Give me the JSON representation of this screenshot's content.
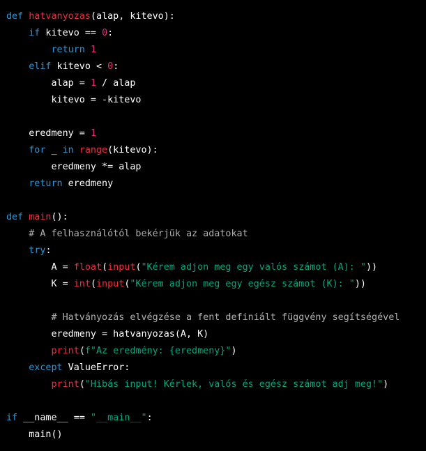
{
  "colors": {
    "background": "#000000",
    "keyword": "#2e95d3",
    "function_name": "#f22c3d",
    "number": "#df3079",
    "string": "#00a67d",
    "comment": "#b0b0b0",
    "text": "#ffffff"
  },
  "code": {
    "language": "python",
    "lines": [
      [
        {
          "t": "kw",
          "v": "def "
        },
        {
          "t": "fn",
          "v": "hatvanyozas"
        },
        {
          "t": "tx",
          "v": "(alap, kitevo):"
        }
      ],
      [
        {
          "t": "tx",
          "v": "    "
        },
        {
          "t": "kw",
          "v": "if"
        },
        {
          "t": "tx",
          "v": " kitevo == "
        },
        {
          "t": "num",
          "v": "0"
        },
        {
          "t": "tx",
          "v": ":"
        }
      ],
      [
        {
          "t": "tx",
          "v": "        "
        },
        {
          "t": "kw",
          "v": "return"
        },
        {
          "t": "tx",
          "v": " "
        },
        {
          "t": "num",
          "v": "1"
        }
      ],
      [
        {
          "t": "tx",
          "v": "    "
        },
        {
          "t": "kw",
          "v": "elif"
        },
        {
          "t": "tx",
          "v": " kitevo < "
        },
        {
          "t": "num",
          "v": "0"
        },
        {
          "t": "tx",
          "v": ":"
        }
      ],
      [
        {
          "t": "tx",
          "v": "        alap = "
        },
        {
          "t": "num",
          "v": "1"
        },
        {
          "t": "tx",
          "v": " / alap"
        }
      ],
      [
        {
          "t": "tx",
          "v": "        kitevo = -kitevo"
        }
      ],
      [],
      [
        {
          "t": "tx",
          "v": "    eredmeny = "
        },
        {
          "t": "num",
          "v": "1"
        }
      ],
      [
        {
          "t": "tx",
          "v": "    "
        },
        {
          "t": "kw",
          "v": "for"
        },
        {
          "t": "tx",
          "v": " _ "
        },
        {
          "t": "kw",
          "v": "in"
        },
        {
          "t": "tx",
          "v": " "
        },
        {
          "t": "fn",
          "v": "range"
        },
        {
          "t": "tx",
          "v": "(kitevo):"
        }
      ],
      [
        {
          "t": "tx",
          "v": "        eredmeny *= alap"
        }
      ],
      [
        {
          "t": "tx",
          "v": "    "
        },
        {
          "t": "kw",
          "v": "return"
        },
        {
          "t": "tx",
          "v": " eredmeny"
        }
      ],
      [],
      [
        {
          "t": "kw",
          "v": "def "
        },
        {
          "t": "fn",
          "v": "main"
        },
        {
          "t": "tx",
          "v": "():"
        }
      ],
      [
        {
          "t": "tx",
          "v": "    "
        },
        {
          "t": "cm",
          "v": "# A felhasználótól bekérjük az adatokat"
        }
      ],
      [
        {
          "t": "tx",
          "v": "    "
        },
        {
          "t": "kw",
          "v": "try"
        },
        {
          "t": "tx",
          "v": ":"
        }
      ],
      [
        {
          "t": "tx",
          "v": "        A = "
        },
        {
          "t": "fn",
          "v": "float"
        },
        {
          "t": "tx",
          "v": "("
        },
        {
          "t": "fn",
          "v": "input"
        },
        {
          "t": "tx",
          "v": "("
        },
        {
          "t": "str",
          "v": "\"Kérem adjon meg egy valós számot (A): \""
        },
        {
          "t": "tx",
          "v": "))"
        }
      ],
      [
        {
          "t": "tx",
          "v": "        K = "
        },
        {
          "t": "fn",
          "v": "int"
        },
        {
          "t": "tx",
          "v": "("
        },
        {
          "t": "fn",
          "v": "input"
        },
        {
          "t": "tx",
          "v": "("
        },
        {
          "t": "str",
          "v": "\"Kérem adjon meg egy egész számot (K): \""
        },
        {
          "t": "tx",
          "v": "))"
        }
      ],
      [],
      [
        {
          "t": "tx",
          "v": "        "
        },
        {
          "t": "cm",
          "v": "# Hatványozás elvégzése a fent definiált függvény segítségével"
        }
      ],
      [
        {
          "t": "tx",
          "v": "        eredmeny = hatvanyozas(A, K)"
        }
      ],
      [
        {
          "t": "tx",
          "v": "        "
        },
        {
          "t": "fn",
          "v": "print"
        },
        {
          "t": "tx",
          "v": "("
        },
        {
          "t": "str",
          "v": "f\"Az eredmény: {eredmeny}\""
        },
        {
          "t": "tx",
          "v": ")"
        }
      ],
      [
        {
          "t": "tx",
          "v": "    "
        },
        {
          "t": "kw",
          "v": "except"
        },
        {
          "t": "tx",
          "v": " ValueError:"
        }
      ],
      [
        {
          "t": "tx",
          "v": "        "
        },
        {
          "t": "fn",
          "v": "print"
        },
        {
          "t": "tx",
          "v": "("
        },
        {
          "t": "str",
          "v": "\"Hibás input! Kérlek, valós és egész számot adj meg!\""
        },
        {
          "t": "tx",
          "v": ")"
        }
      ],
      [],
      [
        {
          "t": "kw",
          "v": "if"
        },
        {
          "t": "tx",
          "v": " __name__ == "
        },
        {
          "t": "str",
          "v": "\"__main__\""
        },
        {
          "t": "tx",
          "v": ":"
        }
      ],
      [
        {
          "t": "tx",
          "v": "    main()"
        }
      ]
    ]
  }
}
